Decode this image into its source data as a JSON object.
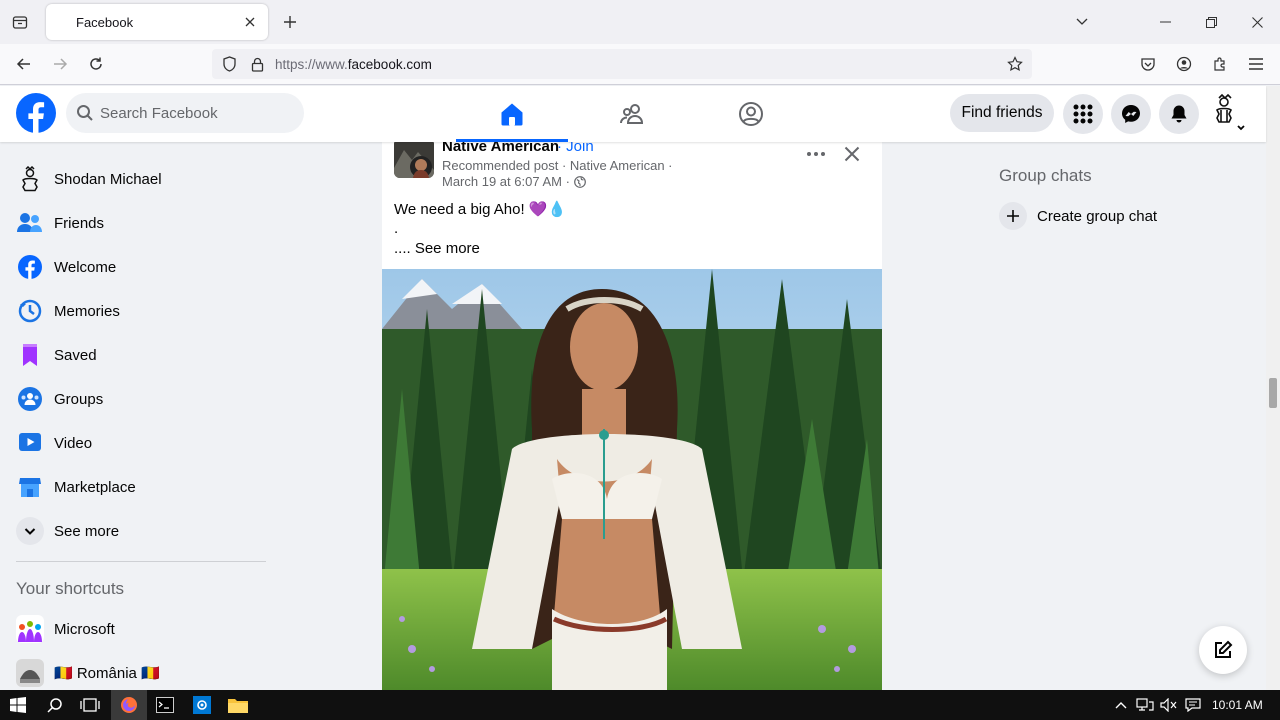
{
  "browser": {
    "tab_title": "Facebook",
    "url_prefix": "https://www.",
    "url_domain": "facebook.com"
  },
  "header": {
    "search_placeholder": "Search Facebook",
    "find_friends_label": "Find friends"
  },
  "sidebar": {
    "items": [
      {
        "label": "Shodan Michael",
        "icon": "profile-avatar-icon"
      },
      {
        "label": "Friends",
        "icon": "friends-icon"
      },
      {
        "label": "Welcome",
        "icon": "facebook-icon"
      },
      {
        "label": "Memories",
        "icon": "clock-icon"
      },
      {
        "label": "Saved",
        "icon": "bookmark-icon"
      },
      {
        "label": "Groups",
        "icon": "groups-icon"
      },
      {
        "label": "Video",
        "icon": "video-icon"
      },
      {
        "label": "Marketplace",
        "icon": "marketplace-icon"
      },
      {
        "label": "See more",
        "icon": "chevron-down-icon"
      }
    ],
    "shortcuts_title": "Your shortcuts",
    "shortcuts": [
      {
        "label": "Microsoft"
      },
      {
        "label": "🇷🇴 România 🇷🇴"
      }
    ]
  },
  "post": {
    "group_name": "Native American",
    "join_label": "· Join",
    "meta_line1": "Recommended post · Native American ·",
    "meta_date": "March 19 at 6:07 AM ·",
    "text": "We need a big Aho! 💜💧",
    "dot": ".",
    "see_more": ".... See more"
  },
  "right_sidebar": {
    "group_chats_title": "Group chats",
    "create_group_chat_label": "Create group chat"
  },
  "taskbar": {
    "time": "10:01 AM"
  },
  "colors": {
    "facebook_blue": "#0866ff",
    "background": "#f0f2f5"
  }
}
